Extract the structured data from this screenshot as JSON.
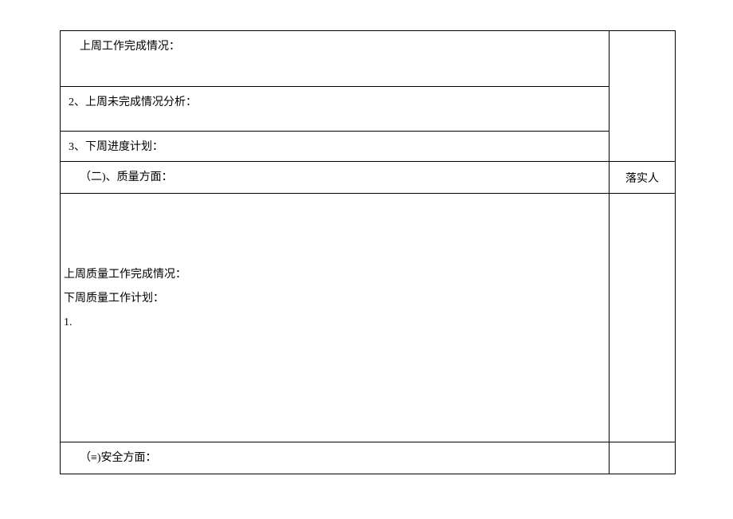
{
  "rows": {
    "r1_left": "上周工作完成情况：",
    "r2_left": "2、上周未完成情况分析：",
    "r3_left": "3、下周进度计划：",
    "r4_left": "（二)、质量方面：",
    "r4_right": "落实人",
    "r5_line1": "上周质量工作完成情况：",
    "r5_line2": "下周质量工作计划：",
    "r5_line3": "1.",
    "r6_left": "（≡)安全方面："
  }
}
